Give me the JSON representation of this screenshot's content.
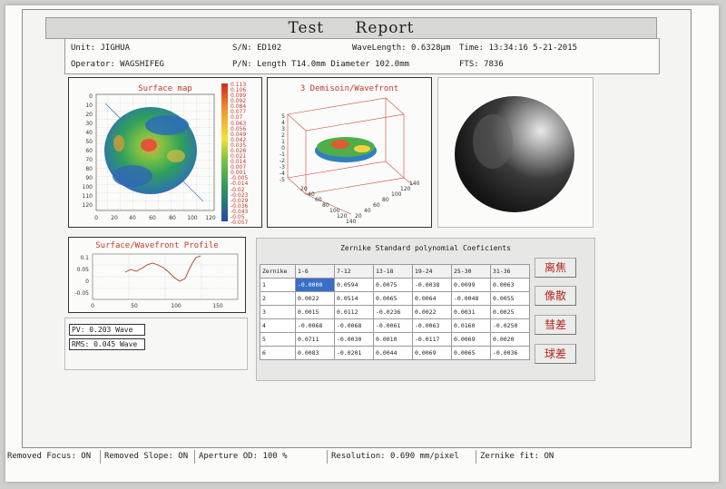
{
  "report": {
    "title_word1": "Test",
    "title_word2": "Report"
  },
  "info": {
    "unit": "Unit: JIGHUA",
    "sn": "S/N: ED102",
    "wavelength": "WaveLength: 0.6328μm",
    "time": "Time: 13:34:16 5-21-2015",
    "operator": "Operator: WAGSHIFEG",
    "pn": "P/N: Length T14.0mm  Diameter 102.0mm",
    "fts": "FTS: 7836"
  },
  "surface_map": {
    "title": "Surface map",
    "y_ticks": [
      "0",
      "10",
      "20",
      "30",
      "40",
      "50",
      "60",
      "70",
      "80",
      "90",
      "100",
      "110",
      "120"
    ],
    "x_ticks": [
      "0",
      "20",
      "40",
      "60",
      "80",
      "100",
      "120"
    ],
    "legend": [
      "0.113",
      "0.106",
      "0.099",
      "0.092",
      "0.084",
      "0.077",
      "0.07",
      "0.063",
      "0.056",
      "0.049",
      "0.042",
      "0.035",
      "0.028",
      "0.021",
      "0.014",
      "0.007",
      "0.001",
      "-0.005",
      "-0.014",
      "-0.02",
      "-0.023",
      "-0.029",
      "-0.036",
      "-0.043",
      "-0.05",
      "-0.057"
    ]
  },
  "wavefront3d": {
    "title": "3 Demisoin/Wavefront",
    "z_ticks": [
      "5",
      "4",
      "3",
      "2",
      "1",
      "0",
      "-1",
      "-2",
      "-3",
      "-4",
      "-5"
    ],
    "x_ticks": [
      "20",
      "40",
      "60",
      "80",
      "100",
      "120",
      "140"
    ],
    "y_ticks": [
      "20",
      "40",
      "60",
      "80",
      "100",
      "120",
      "140"
    ]
  },
  "profile": {
    "title": "Surface/Wavefront Profile",
    "y_ticks": [
      "0.1",
      "0.05",
      "0",
      "-0.05"
    ],
    "x_ticks": [
      "0",
      "50",
      "100",
      "150"
    ]
  },
  "stats": {
    "pv": "PV: 0.203 Wave",
    "rms": "RMS: 0.045 Wave"
  },
  "zernike": {
    "title": "Zernike Standard polynomial Coeficients",
    "headers": [
      "Zernike",
      "1-6",
      "7-12",
      "13-18",
      "19-24",
      "25-30",
      "31-36"
    ],
    "rows": [
      [
        "1",
        "-0.0000",
        "0.0594",
        "0.0075",
        "-0.0038",
        "0.0099",
        "0.0063"
      ],
      [
        "2",
        "0.0022",
        "0.0514",
        "0.0065",
        "0.0064",
        "-0.0048",
        "0.0055"
      ],
      [
        "3",
        "0.0015",
        "0.0112",
        "-0.0236",
        "0.0022",
        "0.0031",
        "0.0025"
      ],
      [
        "4",
        "-0.0068",
        "-0.0068",
        "-0.0061",
        "-0.0063",
        "0.0160",
        "-0.0250"
      ],
      [
        "5",
        "0.0711",
        "-0.0030",
        "0.0010",
        "-0.0117",
        "0.0069",
        "0.0020"
      ],
      [
        "6",
        "0.0083",
        "-0.0201",
        "0.0044",
        "0.0069",
        "0.0065",
        "-0.0036"
      ]
    ],
    "buttons": [
      "离焦",
      "像散",
      "彗差",
      "球差"
    ]
  },
  "status": {
    "removed_focus": "Removed Focus: ON",
    "removed_slope": "Removed Slope: ON",
    "aperture": "Aperture OD: 100  %",
    "resolution": "Resolution: 0.690 mm/pixel",
    "zernike_fit": "Zernike fit: ON"
  }
}
